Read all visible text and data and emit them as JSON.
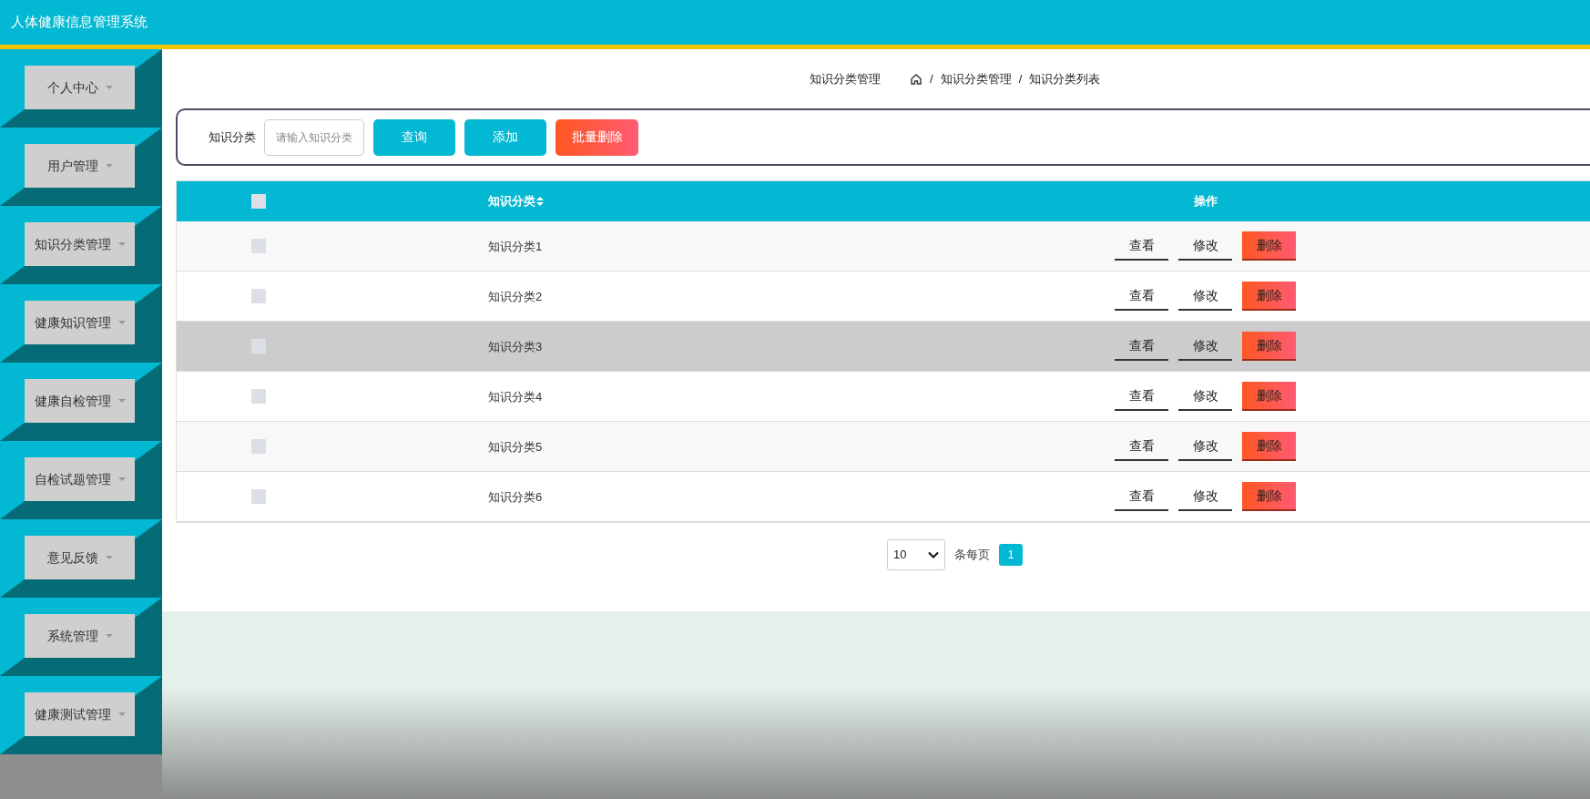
{
  "window": {
    "title": "人体健康信息管理系统"
  },
  "sidebar": {
    "items": [
      {
        "label": "个人中心",
        "has_menu": true
      },
      {
        "label": "用户管理",
        "has_menu": true
      },
      {
        "label": "知识分类管理",
        "has_menu": true
      },
      {
        "label": "健康知识管理",
        "has_menu": true
      },
      {
        "label": "健康自检管理",
        "has_menu": true
      },
      {
        "label": "自检试题管理",
        "has_menu": true
      },
      {
        "label": "意见反馈",
        "has_menu": true
      },
      {
        "label": "系统管理",
        "has_menu": true
      },
      {
        "label": "健康测试管理",
        "has_menu": true
      }
    ]
  },
  "breadcrumb": {
    "title": "知识分类管理",
    "items": [
      {
        "separator": "/",
        "label": "知识分类管理"
      },
      {
        "separator": "/",
        "label": "知识分类列表"
      }
    ]
  },
  "search": {
    "label": "知识分类",
    "placeholder": "请输入知识分类",
    "buttons": [
      {
        "label": "查询",
        "kind": "primary"
      },
      {
        "label": "添加",
        "kind": "primary"
      },
      {
        "label": "批量删除",
        "kind": "danger"
      }
    ]
  },
  "table": {
    "select_all": {
      "checked": false
    },
    "columns": [
      {
        "label": "知识分类",
        "sortable": true
      },
      {
        "label": "操作",
        "sortable": false
      }
    ],
    "rows": [
      {
        "checked": false,
        "name": "知识分类1",
        "highlighted": false,
        "actions": [
          {
            "label": "查看",
            "kind": "link"
          },
          {
            "label": "修改",
            "kind": "link"
          },
          {
            "label": "删除",
            "kind": "danger"
          }
        ]
      },
      {
        "checked": false,
        "name": "知识分类2",
        "highlighted": false,
        "actions": [
          {
            "label": "查看",
            "kind": "link"
          },
          {
            "label": "修改",
            "kind": "link"
          },
          {
            "label": "删除",
            "kind": "danger"
          }
        ]
      },
      {
        "checked": false,
        "name": "知识分类3",
        "highlighted": true,
        "actions": [
          {
            "label": "查看",
            "kind": "link"
          },
          {
            "label": "修改",
            "kind": "link"
          },
          {
            "label": "删除",
            "kind": "danger"
          }
        ]
      },
      {
        "checked": false,
        "name": "知识分类4",
        "highlighted": false,
        "actions": [
          {
            "label": "查看",
            "kind": "link"
          },
          {
            "label": "修改",
            "kind": "link"
          },
          {
            "label": "删除",
            "kind": "danger"
          }
        ]
      },
      {
        "checked": false,
        "name": "知识分类5",
        "highlighted": false,
        "actions": [
          {
            "label": "查看",
            "kind": "link"
          },
          {
            "label": "修改",
            "kind": "link"
          },
          {
            "label": "删除",
            "kind": "danger"
          }
        ]
      },
      {
        "checked": false,
        "name": "知识分类6",
        "highlighted": false,
        "actions": [
          {
            "label": "查看",
            "kind": "link"
          },
          {
            "label": "修改",
            "kind": "link"
          },
          {
            "label": "删除",
            "kind": "danger"
          }
        ]
      }
    ]
  },
  "pagination": {
    "page_size": "10",
    "per_page_label": "条每页",
    "pages": [
      {
        "label": "1",
        "selected": true
      }
    ]
  }
}
